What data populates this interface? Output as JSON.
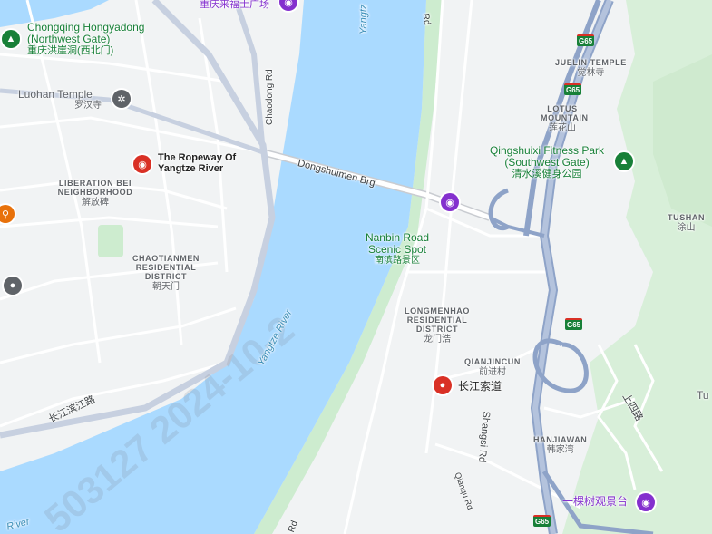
{
  "map": {
    "labels": {
      "hongyadong": "Chongqing Hongyadong (Northwest Gate)",
      "hongyadong_cn": "重庆洪崖洞(西北门)",
      "luohan": "Luohan Temple",
      "luohan_cn": "罗汉寺",
      "fortune_plaza_cn": "重庆来福士广场",
      "ropeway": "The Ropeway Of Yangtze River",
      "liberation": "LIBERATION BEI NEIGHBORHOOD",
      "liberation_cn": "解放碑",
      "chaotianmen": "CHAOTIANMEN RESIDENTIAL DISTRICT",
      "chaotianmen_cn": "朝天门",
      "chaodong_rd": "Chaodong Rd",
      "dongshuimen_brg": "Dongshuimen Brg",
      "nanbin": "Nanbin Road Scenic Spot",
      "nanbin_cn": "南滨路景区",
      "yangtze_river": "Yangtze River",
      "river_bottom": "River",
      "yangtze_top": "Yangtz",
      "longmenhao": "LONGMENHAO RESIDENTIAL DISTRICT",
      "longmenhao_cn": "龙门浩",
      "qianjincun": "QIANJINCUN",
      "qianjincun_cn": "前进村",
      "cable_cn": "长江索道",
      "shangsi_rd": "Shangsi Rd",
      "qianqu_rd": "Qianqu Rd",
      "hanjiawan": "HANJIAWAN",
      "hanjiawan_cn": "韩家湾",
      "yikeshu_cn": "一棵树观景台",
      "juelin": "JUELIN TEMPLE",
      "juelin_cn": "觉林寺",
      "lotus": "LOTUS MOUNTAIN",
      "lotus_cn": "莲花山",
      "qingshuixi": "Qingshuixi Fitness Park (Southwest Gate)",
      "qingshuixi_cn": "清水溪健身公园",
      "tushan": "TUSHAN",
      "tushan_cn": "涂山",
      "changjiang_binjiang": "长江滨江路",
      "shangsi_cn": "上四路",
      "tu_edge": "Tu",
      "rd_top": "Rd",
      "rd_bottom": "Rd",
      "g65": "G65"
    },
    "colors": {
      "water": "#aadaff",
      "land": "#f1f3f4",
      "park": "#cdeccf",
      "highway": "#8ea3c8",
      "road": "#ffffff",
      "poi_green": "#188038",
      "poi_red": "#d93025",
      "poi_purple": "#8430ce"
    },
    "icons": [
      "tree-icon",
      "camera-icon",
      "snowflake-icon",
      "fork-knife-icon",
      "location-pin-icon",
      "compass-icon"
    ],
    "watermark": "503127 2024-10-2"
  }
}
